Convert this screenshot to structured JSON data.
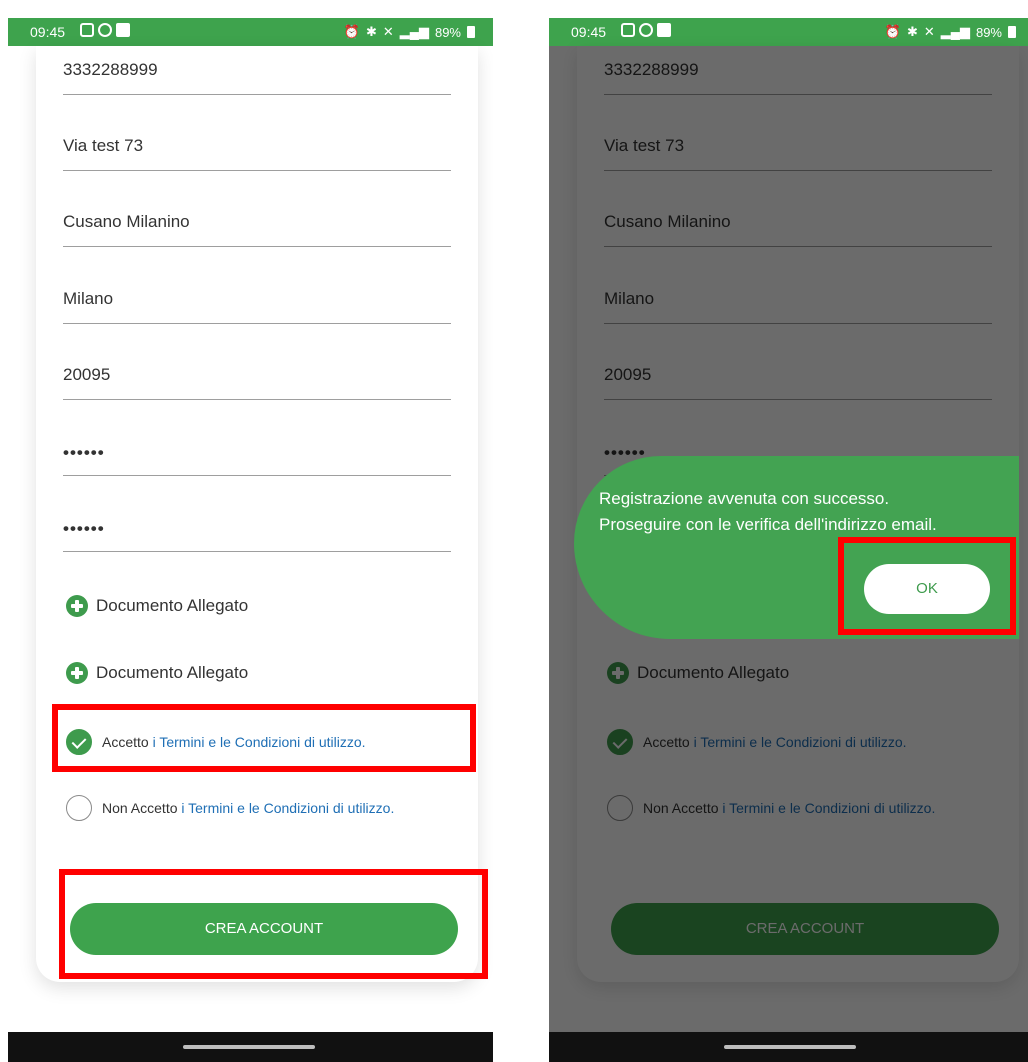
{
  "status_bar": {
    "time": "09:45",
    "battery": "89%"
  },
  "form": {
    "phone": "3332288999",
    "address": "Via test 73",
    "city": "Cusano Milanino",
    "province": "Milano",
    "zip": "20095",
    "password": "••••••",
    "confirm_password": "••••••",
    "attachments": [
      "Documento Allegato",
      "Documento Allegato"
    ],
    "accept_prefix": "Accetto",
    "reject_prefix": "Non Accetto",
    "terms_link": "i Termini e le Condizioni di utilizzo.",
    "accepted": true,
    "submit_label": "CREA ACCOUNT"
  },
  "dialog": {
    "line1": "Registrazione avvenuta con successo.",
    "line2": "Proseguire con le verifica dell'indirizzo email.",
    "ok_label": "OK"
  },
  "colors": {
    "brand_green": "#3ea34d",
    "link_blue": "#1f6fb5",
    "highlight_red": "#ff0000"
  }
}
